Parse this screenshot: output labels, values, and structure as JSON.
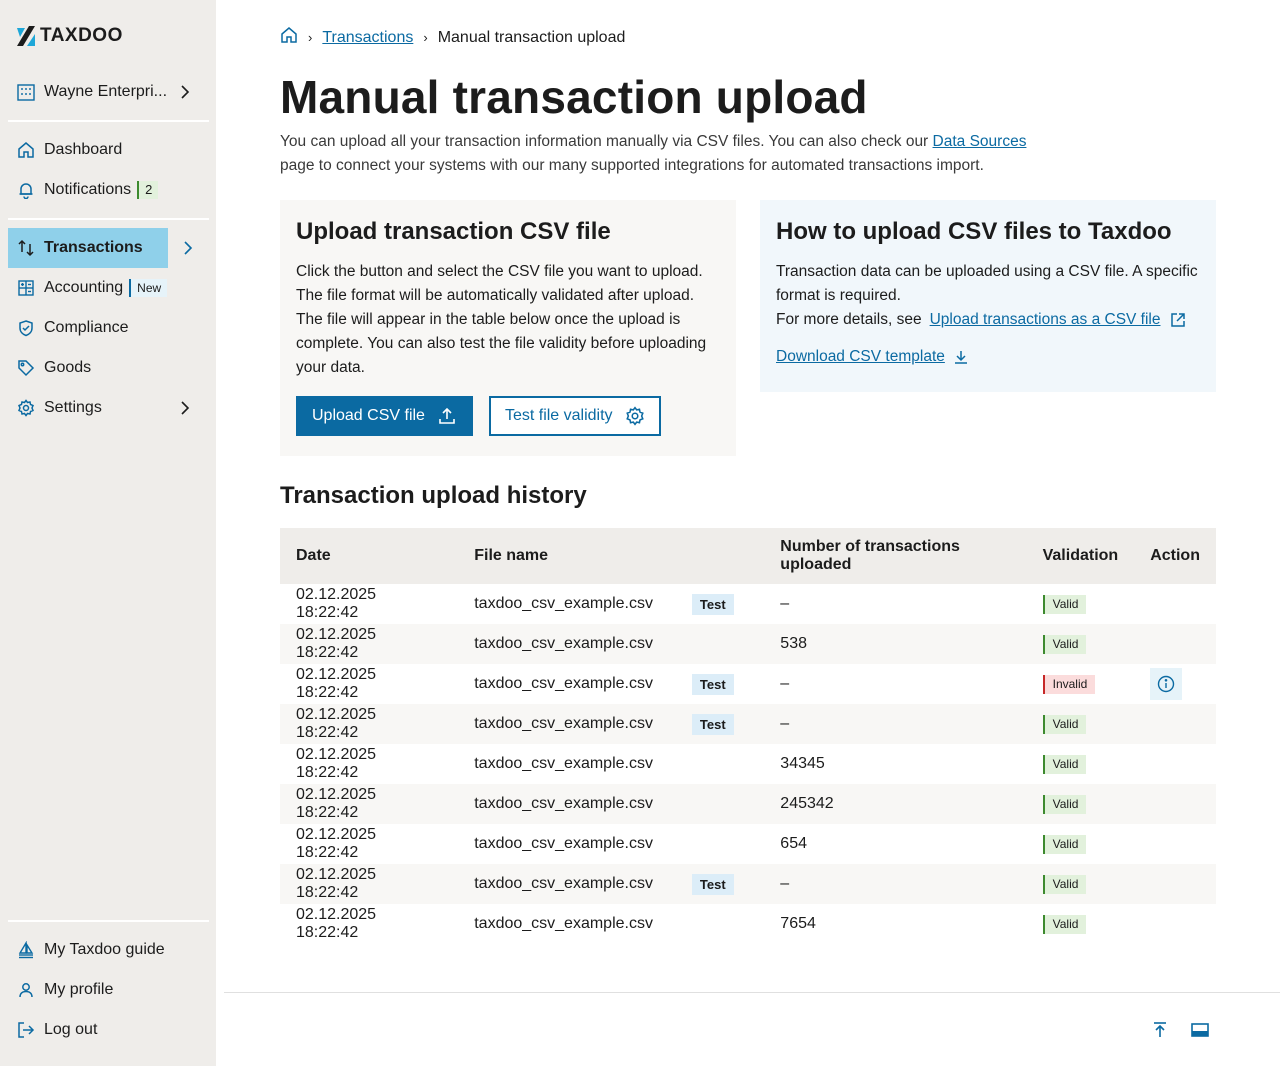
{
  "brand": {
    "name": "TAXDOO",
    "accent": "#0b6aa2",
    "highlight": "#8fd0ea"
  },
  "sidebar": {
    "company": "Wayne Enterpri...",
    "items": [
      {
        "label": "Dashboard",
        "icon": "home-icon"
      },
      {
        "label": "Notifications",
        "icon": "bell-icon",
        "badge": "2"
      },
      {
        "label": "Transactions",
        "icon": "arrows-updown-icon",
        "active": true
      },
      {
        "label": "Accounting",
        "icon": "calculator-icon",
        "badge": "New"
      },
      {
        "label": "Compliance",
        "icon": "shield-icon"
      },
      {
        "label": "Goods",
        "icon": "tag-icon"
      },
      {
        "label": "Settings",
        "icon": "gear-icon"
      }
    ],
    "bottom": [
      {
        "label": "My Taxdoo guide",
        "icon": "sailboat-icon"
      },
      {
        "label": "My profile",
        "icon": "user-icon"
      },
      {
        "label": "Log out",
        "icon": "logout-icon"
      }
    ]
  },
  "breadcrumb": {
    "link": "Transactions",
    "current": "Manual transaction upload"
  },
  "page": {
    "title": "Manual transaction upload",
    "intro_before": "You can upload all your transaction information manually via CSV files. You can also check our ",
    "intro_link": "Data Sources",
    "intro_after": " page to connect your systems with our many supported integrations for automated transactions import."
  },
  "upload_card": {
    "title": "Upload transaction CSV file",
    "body": "Click the button and select the CSV file you want to upload. The file format will be automatically validated after upload. The file will appear in the table below once the upload is complete. You can also test the file validity before uploading your data.",
    "upload_button": "Upload CSV file",
    "test_button": "Test file validity"
  },
  "howto_card": {
    "title": "How to upload CSV files to Taxdoo",
    "body": "Transaction data can be uploaded using a CSV file. A specific format is required.",
    "details_prefix": "For more details, see",
    "details_link": "Upload transactions as a CSV file",
    "download_link": "Download CSV template"
  },
  "history": {
    "title": "Transaction upload history",
    "columns": [
      "Date",
      "File name",
      "Number of transactions uploaded",
      "Validation",
      "Action"
    ],
    "rows": [
      {
        "date": "02.12.2025 18:22:42",
        "file": "taxdoo_csv_example.csv",
        "tag": "Test",
        "count": "–",
        "validation": "Valid",
        "action": false
      },
      {
        "date": "02.12.2025 18:22:42",
        "file": "taxdoo_csv_example.csv",
        "tag": "",
        "count": "538",
        "validation": "Valid",
        "action": false
      },
      {
        "date": "02.12.2025 18:22:42",
        "file": "taxdoo_csv_example.csv",
        "tag": "Test",
        "count": "–",
        "validation": "Invalid",
        "action": true
      },
      {
        "date": "02.12.2025 18:22:42",
        "file": "taxdoo_csv_example.csv",
        "tag": "Test",
        "count": "–",
        "validation": "Valid",
        "action": false
      },
      {
        "date": "02.12.2025 18:22:42",
        "file": "taxdoo_csv_example.csv",
        "tag": "",
        "count": "34345",
        "validation": "Valid",
        "action": false
      },
      {
        "date": "02.12.2025 18:22:42",
        "file": "taxdoo_csv_example.csv",
        "tag": "",
        "count": "245342",
        "validation": "Valid",
        "action": false
      },
      {
        "date": "02.12.2025 18:22:42",
        "file": "taxdoo_csv_example.csv",
        "tag": "",
        "count": "654",
        "validation": "Valid",
        "action": false
      },
      {
        "date": "02.12.2025 18:22:42",
        "file": "taxdoo_csv_example.csv",
        "tag": "Test",
        "count": "–",
        "validation": "Valid",
        "action": false
      },
      {
        "date": "02.12.2025 18:22:42",
        "file": "taxdoo_csv_example.csv",
        "tag": "",
        "count": "7654",
        "validation": "Valid",
        "action": false
      }
    ]
  },
  "footer": {
    "icons": [
      "scroll-to-top-icon",
      "panel-toggle-icon"
    ]
  }
}
